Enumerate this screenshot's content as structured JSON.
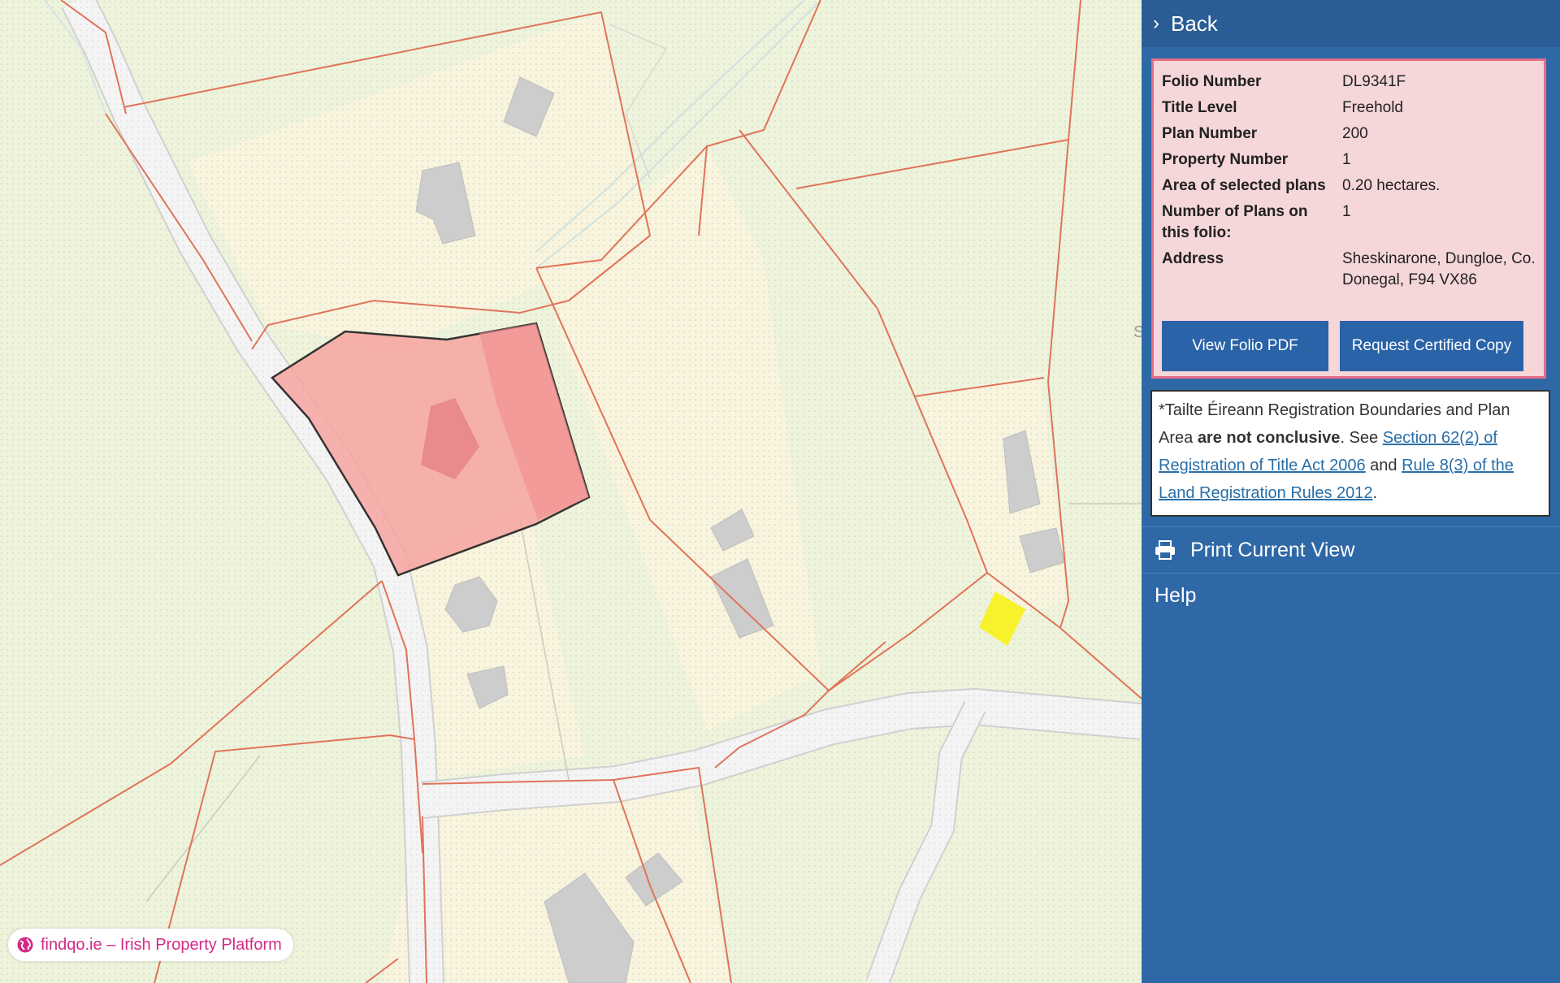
{
  "back": {
    "label": "Back",
    "icon": "chevron-right-icon"
  },
  "folio": {
    "rows": [
      {
        "key": "Folio Number",
        "value": "DL9341F"
      },
      {
        "key": "Title Level",
        "value": "Freehold"
      },
      {
        "key": "Plan Number",
        "value": "200"
      },
      {
        "key": "Property Number",
        "value": "1"
      },
      {
        "key": "Area of selected plans",
        "value": "0.20 hectares."
      },
      {
        "key": "Number of Plans on this folio:",
        "value": "1"
      },
      {
        "key": "Address",
        "value": "Sheskinarone, Dungloe, Co. Donegal, F94 VX86"
      }
    ],
    "view_pdf_label": "View Folio PDF",
    "certified_copy_label": "Request Certified Copy"
  },
  "notice": {
    "text_1": "*Tailte Éireann Registration Boundaries and Plan Area ",
    "bold": "are not conclusive",
    "text_2": ". See ",
    "link_1": "Section 62(2) of Registration of Title Act 2006",
    "text_3": " and ",
    "link_2": "Rule 8(3) of the Land Registration Rules 2012",
    "text_4": "."
  },
  "menu": {
    "print_label": "Print Current View",
    "print_icon": "printer-icon",
    "help_label": "Help"
  },
  "badge": {
    "label": "findqo.ie – Irish Property Platform",
    "icon": "globe-icon"
  },
  "map": {
    "partial_label": "S"
  },
  "colors": {
    "panel": "#2f68a6",
    "folio_bg": "#f5d6d9",
    "folio_border": "#e86d86",
    "button": "#2a63a8",
    "selected_parcel": "#f6a3a0",
    "boundary": "#e0735a",
    "marker": "#f7f22b",
    "badge_text": "#d12b86"
  }
}
